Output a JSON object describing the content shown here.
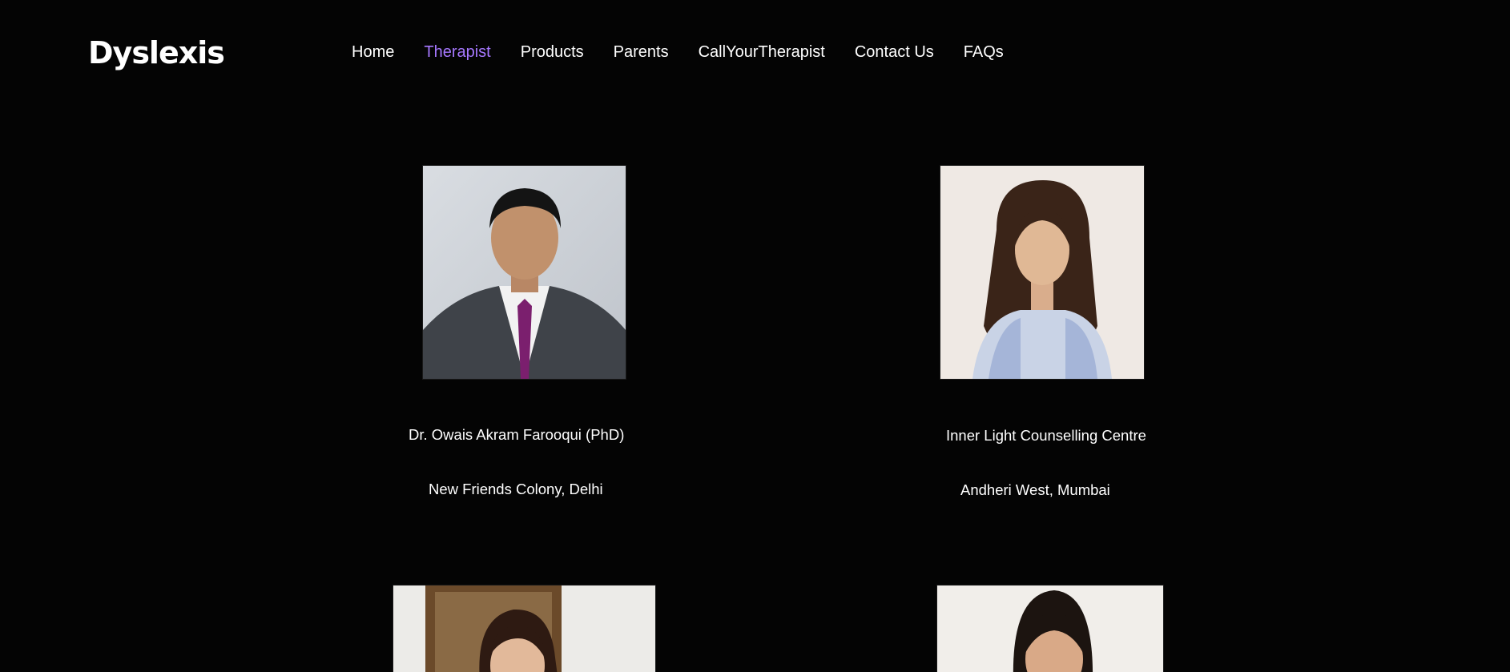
{
  "brand": {
    "logo": "Dyslexis"
  },
  "nav": {
    "items": [
      {
        "label": "Home"
      },
      {
        "label": "Therapist",
        "active": true
      },
      {
        "label": "Products"
      },
      {
        "label": "Parents"
      },
      {
        "label": "CallYourTherapist"
      },
      {
        "label": "Contact Us"
      },
      {
        "label": "FAQs"
      }
    ],
    "active_color": "#a678ff"
  },
  "therapists": [
    {
      "name": "Dr. Owais Akram Farooqui (PhD)",
      "location": "New Friends Colony, Delhi"
    },
    {
      "name": "Inner Light Counselling Centre",
      "location": "Andheri West, Mumbai"
    },
    {
      "name": "",
      "location": ""
    },
    {
      "name": "",
      "location": ""
    }
  ],
  "colors": {
    "background": "#040404",
    "text": "#ffffff"
  }
}
